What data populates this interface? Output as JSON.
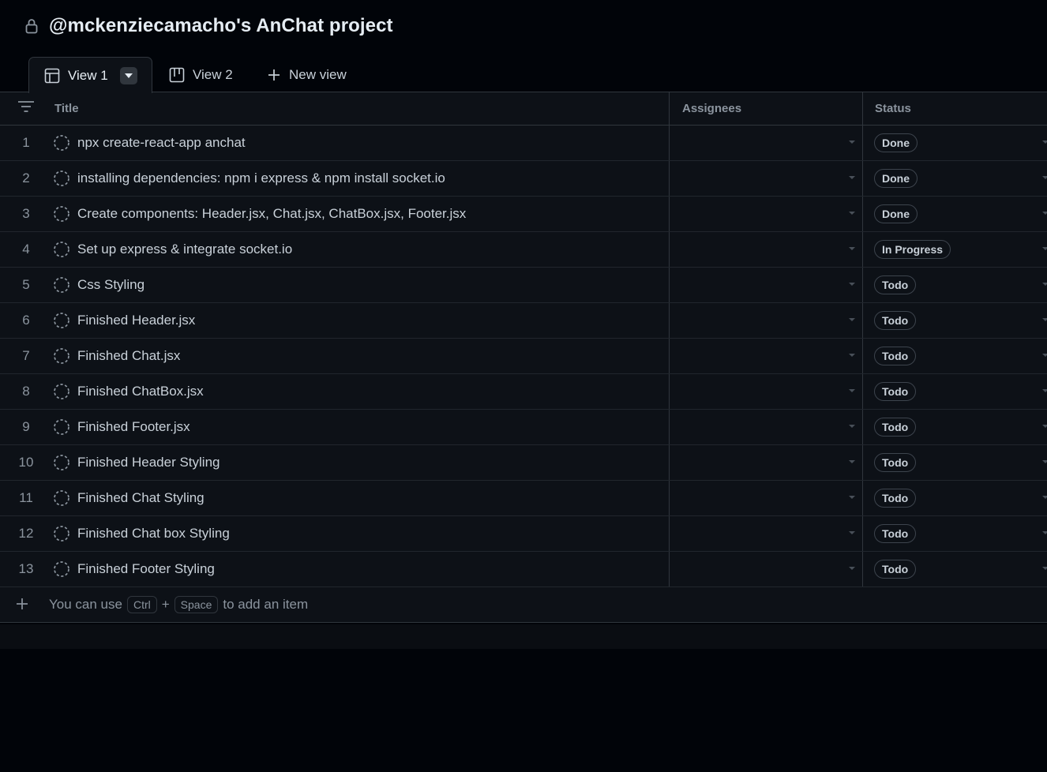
{
  "project": {
    "title": "@mckenziecamacho's AnChat project",
    "lock_icon": "lock-icon"
  },
  "tabs": [
    {
      "label": "View 1",
      "icon": "table-icon",
      "active": true
    },
    {
      "label": "View 2",
      "icon": "board-icon",
      "active": false
    },
    {
      "label": "New view",
      "icon": "plus-icon",
      "active": false
    }
  ],
  "columns": {
    "title": "Title",
    "assignees": "Assignees",
    "status": "Status"
  },
  "items": [
    {
      "num": "1",
      "title": "npx create-react-app anchat",
      "status": "Done"
    },
    {
      "num": "2",
      "title": "installing dependencies: npm i express & npm install socket.io",
      "status": "Done"
    },
    {
      "num": "3",
      "title": "Create components: Header.jsx, Chat.jsx, ChatBox.jsx, Footer.jsx",
      "status": "Done"
    },
    {
      "num": "4",
      "title": "Set up express & integrate socket.io",
      "status": "In Progress"
    },
    {
      "num": "5",
      "title": "Css Styling",
      "status": "Todo"
    },
    {
      "num": "6",
      "title": "Finished Header.jsx",
      "status": "Todo"
    },
    {
      "num": "7",
      "title": "Finished Chat.jsx",
      "status": "Todo"
    },
    {
      "num": "8",
      "title": "Finished ChatBox.jsx",
      "status": "Todo"
    },
    {
      "num": "9",
      "title": "Finished Footer.jsx",
      "status": "Todo"
    },
    {
      "num": "10",
      "title": "Finished Header Styling",
      "status": "Todo"
    },
    {
      "num": "11",
      "title": "Finished Chat Styling",
      "status": "Todo"
    },
    {
      "num": "12",
      "title": "Finished Chat box Styling",
      "status": "Todo"
    },
    {
      "num": "13",
      "title": "Finished Footer Styling",
      "status": "Todo"
    }
  ],
  "add_item": {
    "prefix": "You can use",
    "key1": "Ctrl",
    "plus": "+",
    "key2": "Space",
    "suffix": "to add an item"
  },
  "colors": {
    "background": "#010409",
    "table_background": "#0d1117",
    "border": "#30363d"
  }
}
